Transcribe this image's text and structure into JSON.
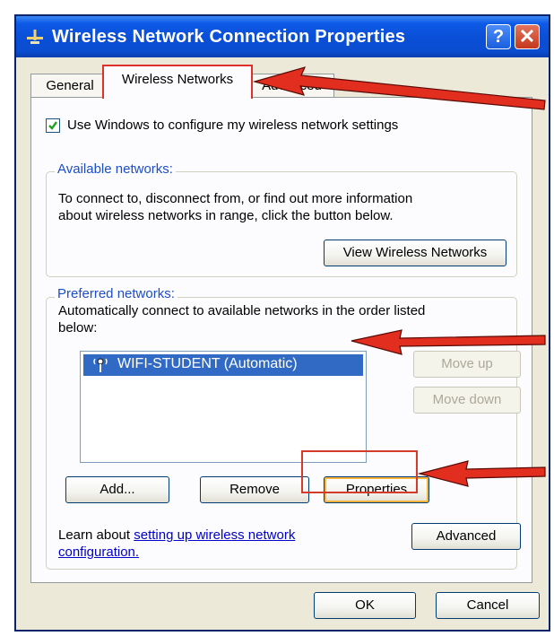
{
  "window": {
    "title": "Wireless Network Connection Properties"
  },
  "titlebar": {
    "help_label": "?",
    "close_label": "✕"
  },
  "tabs": [
    {
      "label": "General"
    },
    {
      "label": "Wireless Networks"
    },
    {
      "label": "Advanced"
    }
  ],
  "settings": {
    "use_windows_label": "Use Windows to configure my wireless network settings",
    "use_windows_checked": true
  },
  "available": {
    "legend": "Available networks:",
    "text_line1": "To connect to, disconnect from, or find out more information",
    "text_line2": "about wireless networks in range, click the button below.",
    "view_button": "View Wireless Networks"
  },
  "preferred": {
    "legend": "Preferred networks:",
    "text_line1": "Automatically connect to available networks in the order listed",
    "text_line2": "below:",
    "networks": [
      {
        "name": "WIFI-STUDENT (Automatic)",
        "icon": "wireless-antenna-icon"
      }
    ],
    "move_up": "Move up",
    "move_down": "Move down",
    "add": "Add...",
    "remove": "Remove",
    "properties": "Properties",
    "learn_prefix": "Learn about",
    "learn_link_line1": "setting up wireless network",
    "learn_link_line2": "configuration.",
    "advanced": "Advanced"
  },
  "footer": {
    "ok": "OK",
    "cancel": "Cancel"
  },
  "colors": {
    "title_bar": "#0b4dd0",
    "legend_text": "#1c4ec8",
    "selection": "#316ac5",
    "annotation_red": "#d43b2a"
  }
}
